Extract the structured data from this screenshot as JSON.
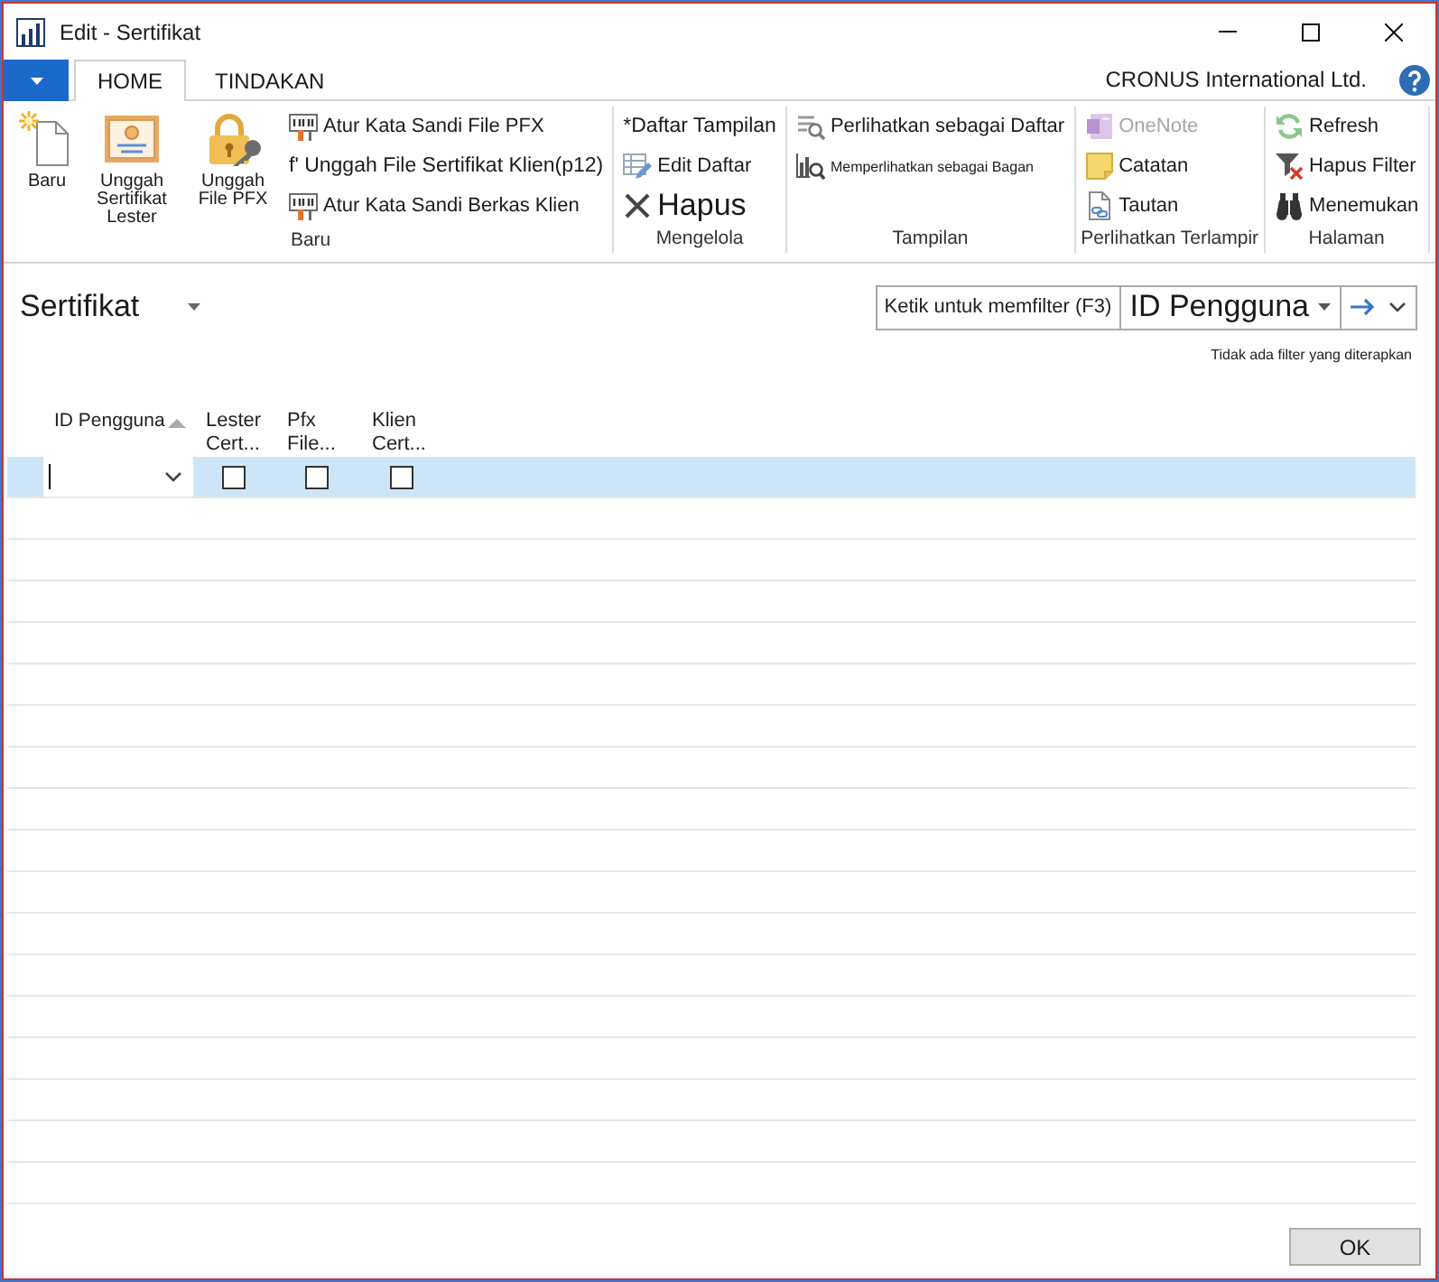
{
  "window": {
    "title": "Edit - Sertifikat"
  },
  "ribbon": {
    "tabs": [
      {
        "label": "HOME",
        "selected": true
      },
      {
        "label": "TINDAKAN",
        "selected": false
      }
    ],
    "company": "CRONUS International Ltd.",
    "groups": [
      {
        "label": "Baru",
        "items": [
          {
            "kind": "large",
            "label": "Baru"
          },
          {
            "kind": "large",
            "label": "Unggah Sertifikat Lester"
          },
          {
            "kind": "large",
            "label": "Unggah File PFX"
          },
          {
            "kind": "small",
            "label": "Atur Kata Sandi File PFX"
          },
          {
            "kind": "plain",
            "label": "f' Unggah File Sertifikat Klien(p12)"
          },
          {
            "kind": "small",
            "label": "Atur Kata Sandi Berkas Klien"
          }
        ]
      },
      {
        "label": "Mengelola",
        "items": [
          {
            "kind": "plain",
            "label": "*Daftar Tampilan"
          },
          {
            "kind": "small",
            "label": "Edit Daftar"
          },
          {
            "kind": "wide",
            "label": "Hapus"
          }
        ]
      },
      {
        "label": "Tampilan",
        "items": [
          {
            "kind": "small",
            "label": "Perlihatkan sebagai Daftar"
          },
          {
            "kind": "compact",
            "label": "Memperlihatkan sebagai Bagan"
          }
        ]
      },
      {
        "label": "Perlihatkan Terlampir",
        "items": [
          {
            "kind": "small",
            "label": "OneNote",
            "disabled": true
          },
          {
            "kind": "small",
            "label": "Catatan",
            "disabled": false
          },
          {
            "kind": "small",
            "label": "Tautan",
            "disabled": false
          }
        ]
      },
      {
        "label": "Halaman",
        "items": [
          {
            "kind": "small",
            "label": "Refresh"
          },
          {
            "kind": "small",
            "label": "Hapus Filter"
          },
          {
            "kind": "small",
            "label": "Menemukan"
          }
        ]
      }
    ]
  },
  "page": {
    "title": "Sertifikat",
    "filter": {
      "placeholder": "Ketik untuk memfilter (F3)",
      "field": "ID Pengguna",
      "status": "Tidak ada filter yang diterapkan"
    }
  },
  "table": {
    "columns": [
      {
        "label": "ID Pengguna",
        "sorted": true
      },
      {
        "label": "Lester Cert...",
        "sorted": false
      },
      {
        "label": "Pfx File...",
        "sorted": false
      },
      {
        "label": "Klien Cert...",
        "sorted": false
      }
    ],
    "rows": [
      {
        "selected": true,
        "cells": [
          {
            "kind": "lookup",
            "editing": true
          },
          {
            "kind": "checkbox",
            "checked": false
          },
          {
            "kind": "checkbox",
            "checked": false
          },
          {
            "kind": "checkbox",
            "checked": false
          }
        ]
      }
    ]
  },
  "buttons": [
    {
      "label": "OK"
    }
  ]
}
